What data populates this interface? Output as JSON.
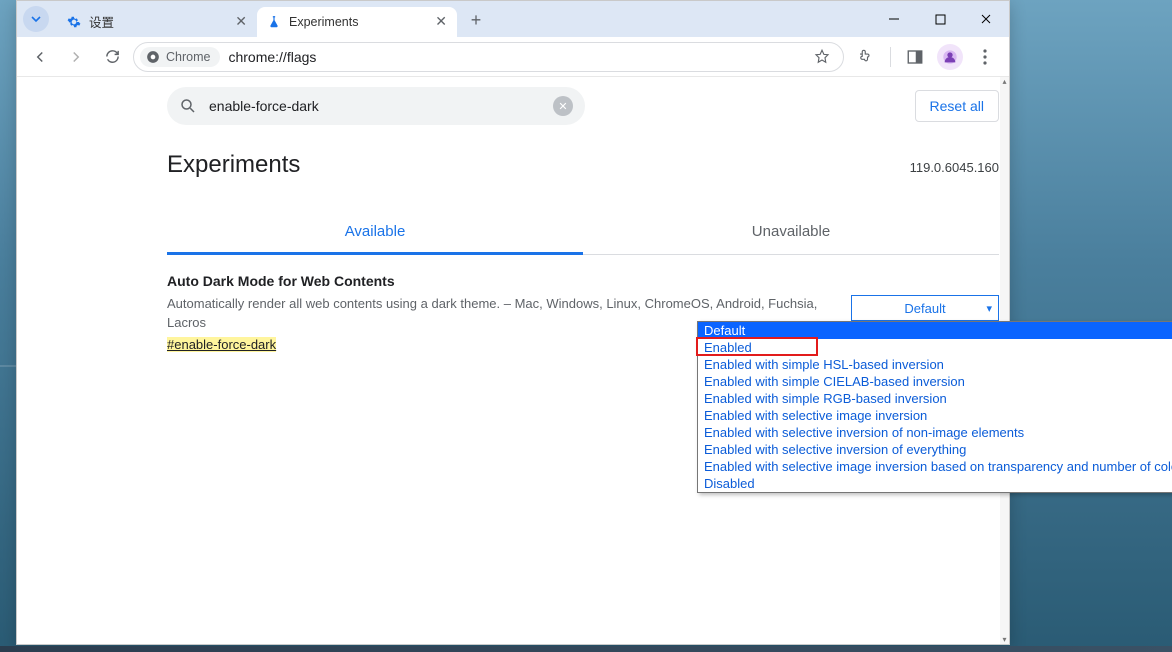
{
  "tabs": [
    {
      "title": "设置",
      "icon": "gear"
    },
    {
      "title": "Experiments",
      "icon": "flask"
    }
  ],
  "omnibox": {
    "badge_label": "Chrome",
    "url": "chrome://flags"
  },
  "page": {
    "search_value": "enable-force-dark",
    "reset_label": "Reset all",
    "heading": "Experiments",
    "version": "119.0.6045.160",
    "tab_available": "Available",
    "tab_unavailable": "Unavailable",
    "flag": {
      "title": "Auto Dark Mode for Web Contents",
      "description": "Automatically render all web contents using a dark theme. – Mac, Windows, Linux, ChromeOS, Android, Fuchsia, Lacros",
      "hash": "#enable-force-dark",
      "select_value": "Default",
      "options": [
        "Default",
        "Enabled",
        "Enabled with simple HSL-based inversion",
        "Enabled with simple CIELAB-based inversion",
        "Enabled with simple RGB-based inversion",
        "Enabled with selective image inversion",
        "Enabled with selective inversion of non-image elements",
        "Enabled with selective inversion of everything",
        "Enabled with selective image inversion based on transparency and number of colors",
        "Disabled"
      ],
      "highlight_index": 1,
      "selected_index": 0
    }
  }
}
